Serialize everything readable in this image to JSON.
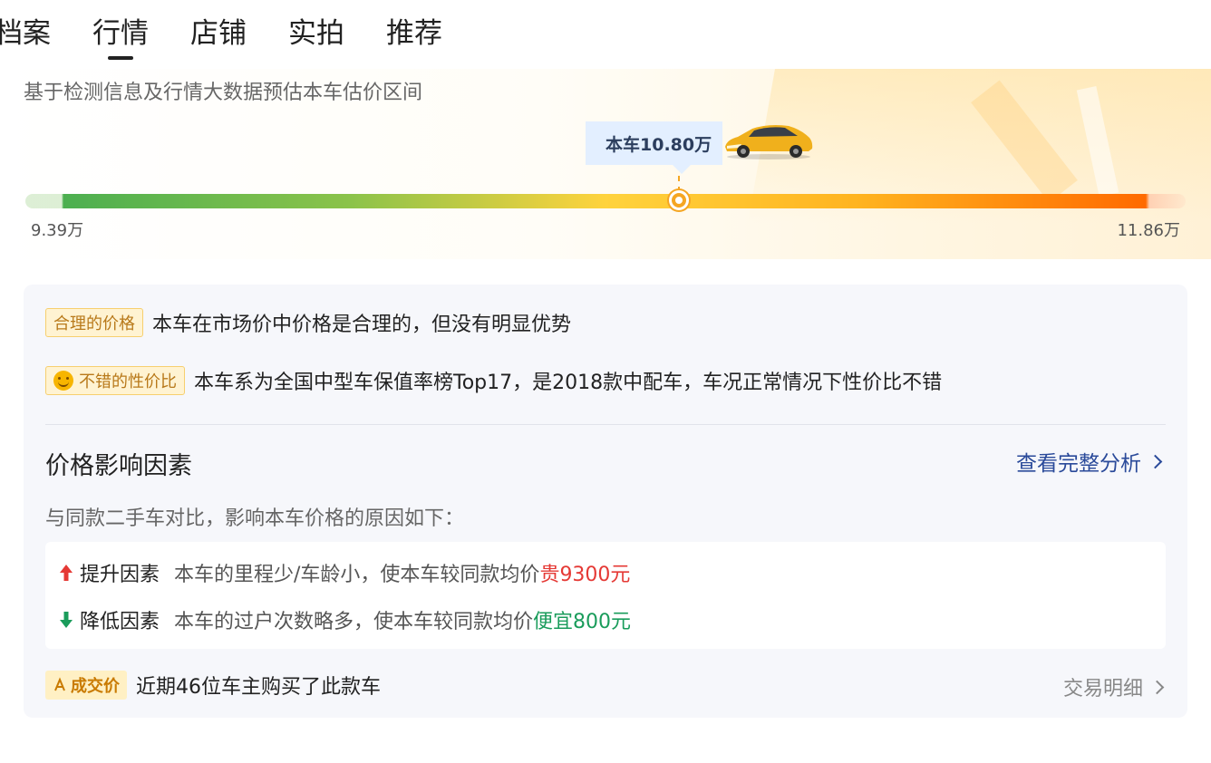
{
  "tabs": [
    {
      "label": "档案",
      "active": false
    },
    {
      "label": "行情",
      "active": true
    },
    {
      "label": "店铺",
      "active": false
    },
    {
      "label": "实拍",
      "active": false
    },
    {
      "label": "推荐",
      "active": false
    }
  ],
  "estimate": {
    "subtitle": "基于检测信息及行情大数据预估本车估价区间",
    "current_price_label": "本车10.80万",
    "min_label": "9.39万",
    "max_label": "11.86万",
    "min_value": 9.39,
    "max_value": 11.86,
    "current_value": 10.8,
    "car_icon": "car-icon"
  },
  "analysis": {
    "tags": [
      {
        "tag": "合理的价格",
        "text": "本车在市场价中价格是合理的，但没有明显优势",
        "icon": ""
      },
      {
        "tag": "不错的性价比",
        "text": "本车系为全国中型车保值率榜Top17，是2018款中配车，车况正常情况下性价比不错",
        "icon": "smile-icon"
      }
    ],
    "factors_title": "价格影响因素",
    "full_analysis_link": "查看完整分析",
    "compare_desc": "与同款二手车对比，影响本车价格的原因如下：",
    "factors": [
      {
        "label": "提升因素",
        "desc": "本车的里程少/车龄小，使本车较同款均价",
        "highlight": "贵9300元",
        "direction": "up",
        "color": "#e53935"
      },
      {
        "label": "降低因素",
        "desc": "本车的过户次数略多，使本车较同款均价",
        "highlight": "便宜800元",
        "direction": "down",
        "color": "#1a9c5b"
      }
    ],
    "deal": {
      "tag": "成交价",
      "text": "近期46位车主购买了此款车",
      "link": "交易明细"
    }
  },
  "colors": {
    "accent_blue": "#2a4a9a",
    "tag_yellow": "#fff3d2",
    "marker_orange": "#f5a623",
    "up_red": "#e53935",
    "down_green": "#1a9c5b"
  }
}
